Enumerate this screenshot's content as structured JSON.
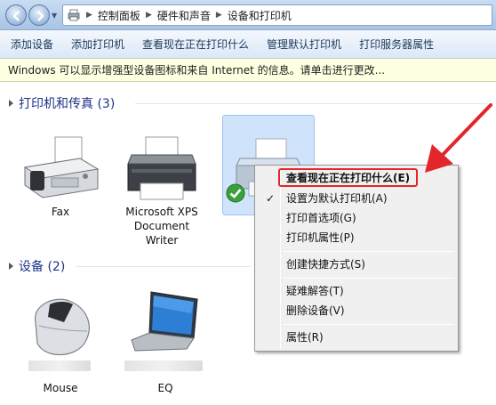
{
  "address_bar": {
    "crumbs": [
      "控制面板",
      "硬件和声音",
      "设备和打印机"
    ]
  },
  "toolbar": {
    "buttons": [
      "添加设备",
      "添加打印机",
      "查看现在正在打印什么",
      "管理默认打印机",
      "打印服务器属性"
    ]
  },
  "infobar": {
    "text": "Windows 可以显示增强型设备图标和来自 Internet 的信息。请单击进行更改..."
  },
  "sections": {
    "printers": {
      "title": "打印机和传真 (3)"
    },
    "devices": {
      "title": "设备 (2)"
    }
  },
  "printers": [
    {
      "label": "Fax",
      "icon": "fax-icon"
    },
    {
      "label": "Microsoft XPS Document Writer",
      "label_lines": [
        "Microsoft XPS",
        "Document",
        "Writer"
      ],
      "icon": "printer-icon"
    },
    {
      "label": "",
      "icon": "printer-icon",
      "status": "default-printer-check-icon"
    }
  ],
  "devices": [
    {
      "label": "Mouse",
      "icon": "mouse-icon"
    },
    {
      "label": "EQ",
      "icon": "laptop-icon"
    }
  ],
  "context_menu": {
    "items": [
      {
        "label": "查看现在正在打印什么(E)",
        "bold": true
      },
      {
        "label": "设置为默认打印机(A)",
        "checked": true
      },
      {
        "label": "打印首选项(G)"
      },
      {
        "label": "打印机属性(P)"
      },
      {
        "label": "创建快捷方式(S)"
      },
      {
        "label": "疑难解答(T)"
      },
      {
        "label": "删除设备(V)"
      },
      {
        "label": "属性(R)"
      }
    ]
  },
  "colors": {
    "annotation": "#e2262b",
    "section_title": "#1e3287",
    "selection": "#cfe3fa"
  }
}
